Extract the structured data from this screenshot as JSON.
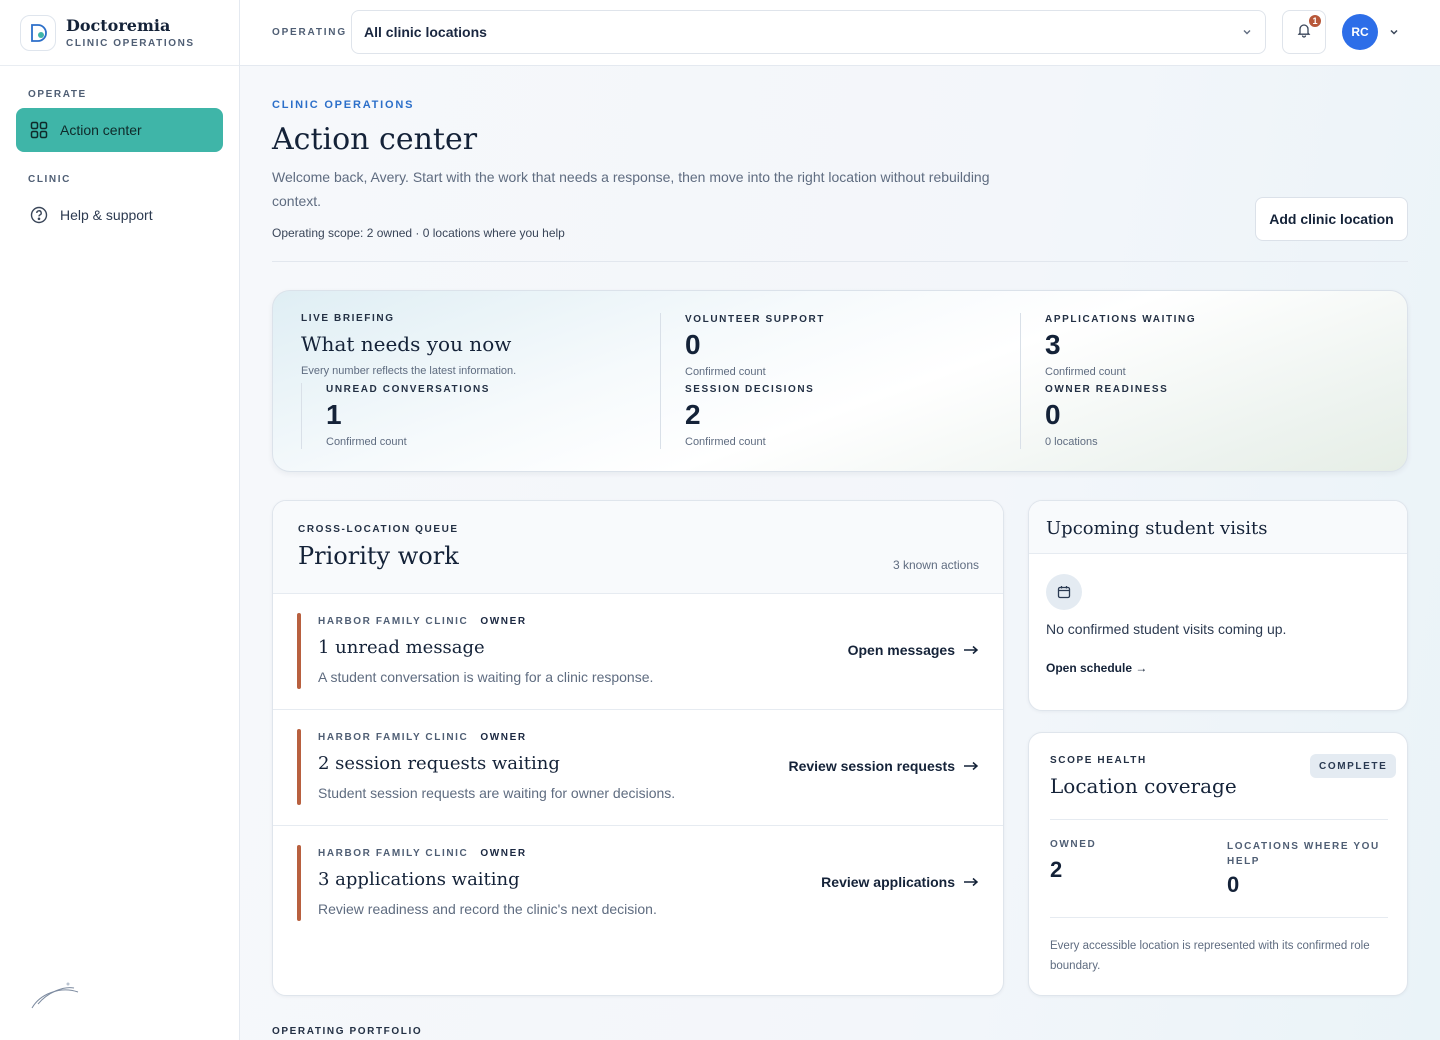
{
  "brand": {
    "name": "Doctoremia",
    "subtitle": "CLINIC OPERATIONS"
  },
  "sidebar": {
    "sections": [
      {
        "label": "OPERATE",
        "items": [
          {
            "label": "Action center",
            "icon": "grid-icon",
            "active": true
          }
        ]
      },
      {
        "label": "CLINIC",
        "items": [
          {
            "label": "Help & support",
            "icon": "help-circle-icon",
            "active": false
          }
        ]
      }
    ]
  },
  "topbar": {
    "operating_label": "OPERATING",
    "location_value": "All clinic locations",
    "notification_count": "1",
    "avatar_initials": "RC"
  },
  "page": {
    "eyebrow": "CLINIC OPERATIONS",
    "title": "Action center",
    "welcome": "Welcome back, Avery. Start with the work that needs a response, then move into the right location without rebuilding context.",
    "scope": "Operating scope: 2 owned · 0 locations where you help",
    "add_button": "Add clinic location"
  },
  "briefing": {
    "eyebrow": "LIVE BRIEFING",
    "title": "What needs you now",
    "subtitle": "Every number reflects the latest information.",
    "metrics": [
      {
        "label": "UNREAD CONVERSATIONS",
        "value": "1",
        "note": "Confirmed count"
      },
      {
        "label": "VOLUNTEER SUPPORT",
        "value": "0",
        "note": "Confirmed count"
      },
      {
        "label": "SESSION DECISIONS",
        "value": "2",
        "note": "Confirmed count"
      },
      {
        "label": "APPLICATIONS WAITING",
        "value": "3",
        "note": "Confirmed count"
      },
      {
        "label": "OWNER READINESS",
        "value": "0",
        "note": "0 locations"
      }
    ]
  },
  "priority": {
    "eyebrow": "CROSS-LOCATION QUEUE",
    "title": "Priority work",
    "count": "3 known actions",
    "items": [
      {
        "clinic": "HARBOR FAMILY CLINIC",
        "role": "OWNER",
        "title": "1 unread message",
        "desc": "A student conversation is waiting for a clinic response.",
        "action": "Open messages"
      },
      {
        "clinic": "HARBOR FAMILY CLINIC",
        "role": "OWNER",
        "title": "2 session requests waiting",
        "desc": "Student session requests are waiting for owner decisions.",
        "action": "Review session requests"
      },
      {
        "clinic": "HARBOR FAMILY CLINIC",
        "role": "OWNER",
        "title": "3 applications waiting",
        "desc": "Review readiness and record the clinic's next decision.",
        "action": "Review applications"
      }
    ]
  },
  "visits": {
    "title": "Upcoming student visits",
    "empty": "No confirmed student visits coming up.",
    "link": "Open schedule →"
  },
  "coverage": {
    "eyebrow": "SCOPE HEALTH",
    "title": "Location coverage",
    "badge": "COMPLETE",
    "owned_label": "OWNED",
    "owned_value": "2",
    "help_label": "LOCATIONS WHERE YOU HELP",
    "help_value": "0",
    "note": "Every accessible location is represented with its confirmed role boundary."
  },
  "portfolio": {
    "eyebrow": "OPERATING PORTFOLIO"
  },
  "colors": {
    "accent_teal": "#3fb5a8",
    "priority_bar": "#b8603f",
    "avatar_blue": "#2d6ee8",
    "eyebrow_blue": "#2c6fc9"
  }
}
